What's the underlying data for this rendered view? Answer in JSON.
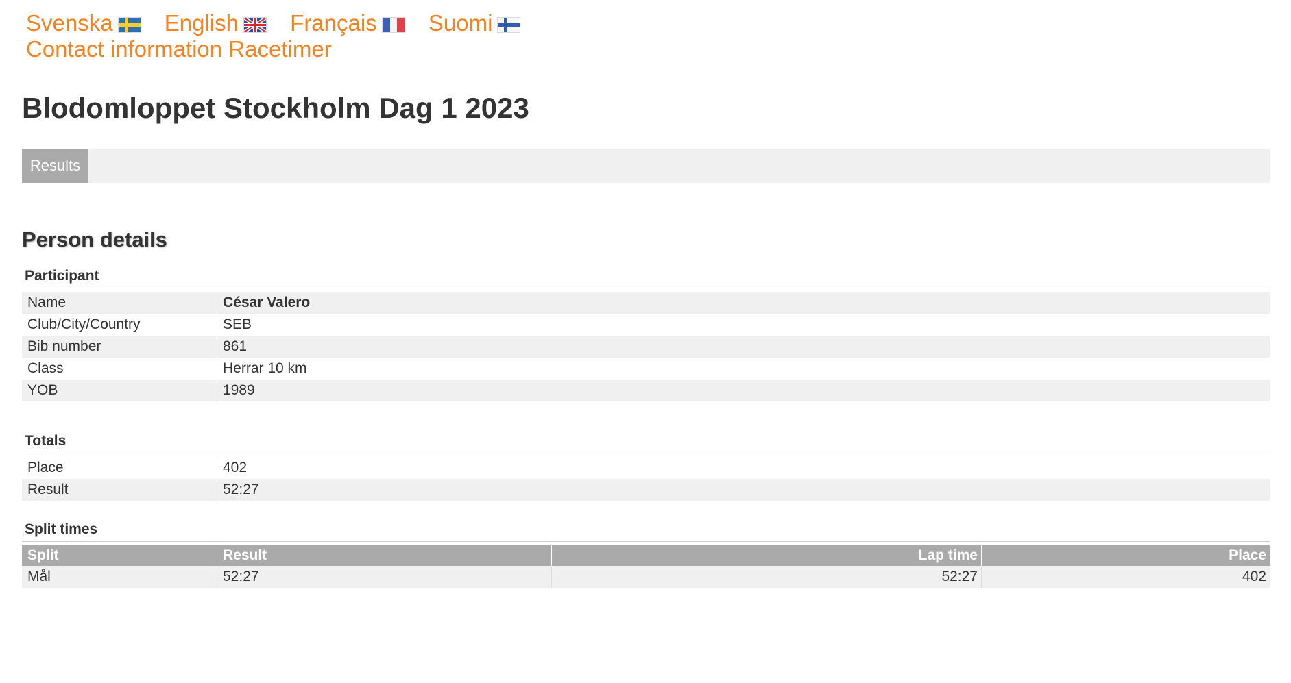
{
  "languages": [
    {
      "label": "Svenska",
      "flag": "sweden-flag-icon"
    },
    {
      "label": "English",
      "flag": "uk-flag-icon"
    },
    {
      "label": "Français",
      "flag": "france-flag-icon"
    },
    {
      "label": "Suomi",
      "flag": "finland-flag-icon"
    }
  ],
  "contact_link": "Contact information Racetimer",
  "event_title": "Blodomloppet Stockholm Dag 1 2023",
  "tabs": [
    {
      "label": "Results",
      "active": true
    }
  ],
  "page_heading": "Person details",
  "participant": {
    "section_title": "Participant",
    "rows": [
      {
        "label": "Name",
        "value": "César Valero"
      },
      {
        "label": "Club/City/Country",
        "value": "SEB"
      },
      {
        "label": "Bib number",
        "value": "861"
      },
      {
        "label": "Class",
        "value": "Herrar 10 km"
      },
      {
        "label": "YOB",
        "value": "1989"
      }
    ]
  },
  "totals": {
    "section_title": "Totals",
    "rows": [
      {
        "label": "Place",
        "value": "402"
      },
      {
        "label": "Result",
        "value": "52:27"
      }
    ]
  },
  "split_times": {
    "section_title": "Split times",
    "headers": [
      "Split",
      "Result",
      "Lap time",
      "Place"
    ],
    "rows": [
      [
        "Mål",
        "52:27",
        "52:27",
        "402"
      ]
    ]
  },
  "colors": {
    "link": "#f58220",
    "header_bg": "#aaaaaa",
    "stripe": "#f0f0f0"
  }
}
